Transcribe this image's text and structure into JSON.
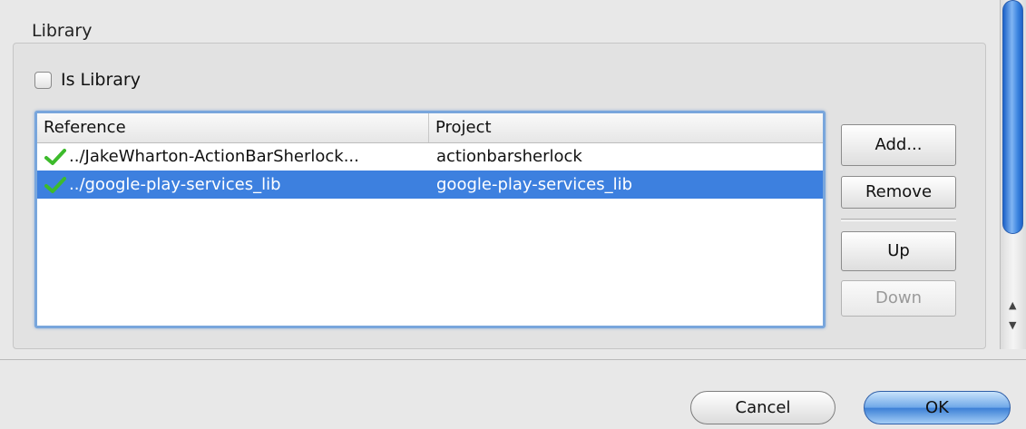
{
  "library": {
    "legend": "Library",
    "is_library_label": "Is Library",
    "is_library_checked": false
  },
  "table": {
    "columns": [
      "Reference",
      "Project"
    ],
    "rows": [
      {
        "reference": "../JakeWharton-ActionBarSherlock...",
        "project": "actionbarsherlock",
        "status_icon": "check-icon",
        "selected": false
      },
      {
        "reference": "../google-play-services_lib",
        "project": "google-play-services_lib",
        "status_icon": "check-icon",
        "selected": true
      }
    ]
  },
  "side_buttons": {
    "add": "Add...",
    "remove": "Remove",
    "up": "Up",
    "down": "Down"
  },
  "dialog": {
    "cancel": "Cancel",
    "ok": "OK"
  },
  "colors": {
    "selection": "#3d80df",
    "check": "#3dbb2c",
    "focus_ring": "#79a6dc"
  }
}
